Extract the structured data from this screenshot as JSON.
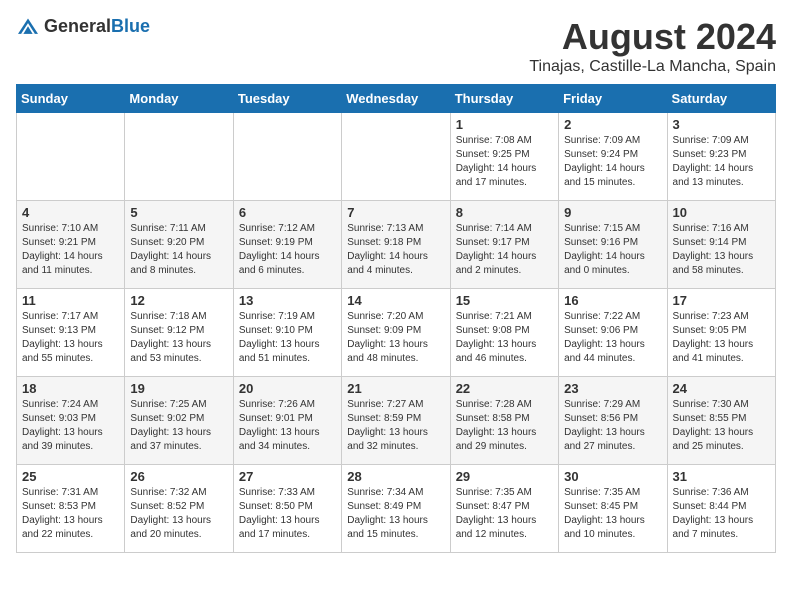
{
  "header": {
    "logo_general": "General",
    "logo_blue": "Blue",
    "month_year": "August 2024",
    "location": "Tinajas, Castille-La Mancha, Spain"
  },
  "days_of_week": [
    "Sunday",
    "Monday",
    "Tuesday",
    "Wednesday",
    "Thursday",
    "Friday",
    "Saturday"
  ],
  "weeks": [
    [
      {
        "day": "",
        "sunrise": "",
        "sunset": "",
        "daylight": ""
      },
      {
        "day": "",
        "sunrise": "",
        "sunset": "",
        "daylight": ""
      },
      {
        "day": "",
        "sunrise": "",
        "sunset": "",
        "daylight": ""
      },
      {
        "day": "",
        "sunrise": "",
        "sunset": "",
        "daylight": ""
      },
      {
        "day": "1",
        "sunrise": "Sunrise: 7:08 AM",
        "sunset": "Sunset: 9:25 PM",
        "daylight": "Daylight: 14 hours and 17 minutes."
      },
      {
        "day": "2",
        "sunrise": "Sunrise: 7:09 AM",
        "sunset": "Sunset: 9:24 PM",
        "daylight": "Daylight: 14 hours and 15 minutes."
      },
      {
        "day": "3",
        "sunrise": "Sunrise: 7:09 AM",
        "sunset": "Sunset: 9:23 PM",
        "daylight": "Daylight: 14 hours and 13 minutes."
      }
    ],
    [
      {
        "day": "4",
        "sunrise": "Sunrise: 7:10 AM",
        "sunset": "Sunset: 9:21 PM",
        "daylight": "Daylight: 14 hours and 11 minutes."
      },
      {
        "day": "5",
        "sunrise": "Sunrise: 7:11 AM",
        "sunset": "Sunset: 9:20 PM",
        "daylight": "Daylight: 14 hours and 8 minutes."
      },
      {
        "day": "6",
        "sunrise": "Sunrise: 7:12 AM",
        "sunset": "Sunset: 9:19 PM",
        "daylight": "Daylight: 14 hours and 6 minutes."
      },
      {
        "day": "7",
        "sunrise": "Sunrise: 7:13 AM",
        "sunset": "Sunset: 9:18 PM",
        "daylight": "Daylight: 14 hours and 4 minutes."
      },
      {
        "day": "8",
        "sunrise": "Sunrise: 7:14 AM",
        "sunset": "Sunset: 9:17 PM",
        "daylight": "Daylight: 14 hours and 2 minutes."
      },
      {
        "day": "9",
        "sunrise": "Sunrise: 7:15 AM",
        "sunset": "Sunset: 9:16 PM",
        "daylight": "Daylight: 14 hours and 0 minutes."
      },
      {
        "day": "10",
        "sunrise": "Sunrise: 7:16 AM",
        "sunset": "Sunset: 9:14 PM",
        "daylight": "Daylight: 13 hours and 58 minutes."
      }
    ],
    [
      {
        "day": "11",
        "sunrise": "Sunrise: 7:17 AM",
        "sunset": "Sunset: 9:13 PM",
        "daylight": "Daylight: 13 hours and 55 minutes."
      },
      {
        "day": "12",
        "sunrise": "Sunrise: 7:18 AM",
        "sunset": "Sunset: 9:12 PM",
        "daylight": "Daylight: 13 hours and 53 minutes."
      },
      {
        "day": "13",
        "sunrise": "Sunrise: 7:19 AM",
        "sunset": "Sunset: 9:10 PM",
        "daylight": "Daylight: 13 hours and 51 minutes."
      },
      {
        "day": "14",
        "sunrise": "Sunrise: 7:20 AM",
        "sunset": "Sunset: 9:09 PM",
        "daylight": "Daylight: 13 hours and 48 minutes."
      },
      {
        "day": "15",
        "sunrise": "Sunrise: 7:21 AM",
        "sunset": "Sunset: 9:08 PM",
        "daylight": "Daylight: 13 hours and 46 minutes."
      },
      {
        "day": "16",
        "sunrise": "Sunrise: 7:22 AM",
        "sunset": "Sunset: 9:06 PM",
        "daylight": "Daylight: 13 hours and 44 minutes."
      },
      {
        "day": "17",
        "sunrise": "Sunrise: 7:23 AM",
        "sunset": "Sunset: 9:05 PM",
        "daylight": "Daylight: 13 hours and 41 minutes."
      }
    ],
    [
      {
        "day": "18",
        "sunrise": "Sunrise: 7:24 AM",
        "sunset": "Sunset: 9:03 PM",
        "daylight": "Daylight: 13 hours and 39 minutes."
      },
      {
        "day": "19",
        "sunrise": "Sunrise: 7:25 AM",
        "sunset": "Sunset: 9:02 PM",
        "daylight": "Daylight: 13 hours and 37 minutes."
      },
      {
        "day": "20",
        "sunrise": "Sunrise: 7:26 AM",
        "sunset": "Sunset: 9:01 PM",
        "daylight": "Daylight: 13 hours and 34 minutes."
      },
      {
        "day": "21",
        "sunrise": "Sunrise: 7:27 AM",
        "sunset": "Sunset: 8:59 PM",
        "daylight": "Daylight: 13 hours and 32 minutes."
      },
      {
        "day": "22",
        "sunrise": "Sunrise: 7:28 AM",
        "sunset": "Sunset: 8:58 PM",
        "daylight": "Daylight: 13 hours and 29 minutes."
      },
      {
        "day": "23",
        "sunrise": "Sunrise: 7:29 AM",
        "sunset": "Sunset: 8:56 PM",
        "daylight": "Daylight: 13 hours and 27 minutes."
      },
      {
        "day": "24",
        "sunrise": "Sunrise: 7:30 AM",
        "sunset": "Sunset: 8:55 PM",
        "daylight": "Daylight: 13 hours and 25 minutes."
      }
    ],
    [
      {
        "day": "25",
        "sunrise": "Sunrise: 7:31 AM",
        "sunset": "Sunset: 8:53 PM",
        "daylight": "Daylight: 13 hours and 22 minutes."
      },
      {
        "day": "26",
        "sunrise": "Sunrise: 7:32 AM",
        "sunset": "Sunset: 8:52 PM",
        "daylight": "Daylight: 13 hours and 20 minutes."
      },
      {
        "day": "27",
        "sunrise": "Sunrise: 7:33 AM",
        "sunset": "Sunset: 8:50 PM",
        "daylight": "Daylight: 13 hours and 17 minutes."
      },
      {
        "day": "28",
        "sunrise": "Sunrise: 7:34 AM",
        "sunset": "Sunset: 8:49 PM",
        "daylight": "Daylight: 13 hours and 15 minutes."
      },
      {
        "day": "29",
        "sunrise": "Sunrise: 7:35 AM",
        "sunset": "Sunset: 8:47 PM",
        "daylight": "Daylight: 13 hours and 12 minutes."
      },
      {
        "day": "30",
        "sunrise": "Sunrise: 7:35 AM",
        "sunset": "Sunset: 8:45 PM",
        "daylight": "Daylight: 13 hours and 10 minutes."
      },
      {
        "day": "31",
        "sunrise": "Sunrise: 7:36 AM",
        "sunset": "Sunset: 8:44 PM",
        "daylight": "Daylight: 13 hours and 7 minutes."
      }
    ]
  ]
}
